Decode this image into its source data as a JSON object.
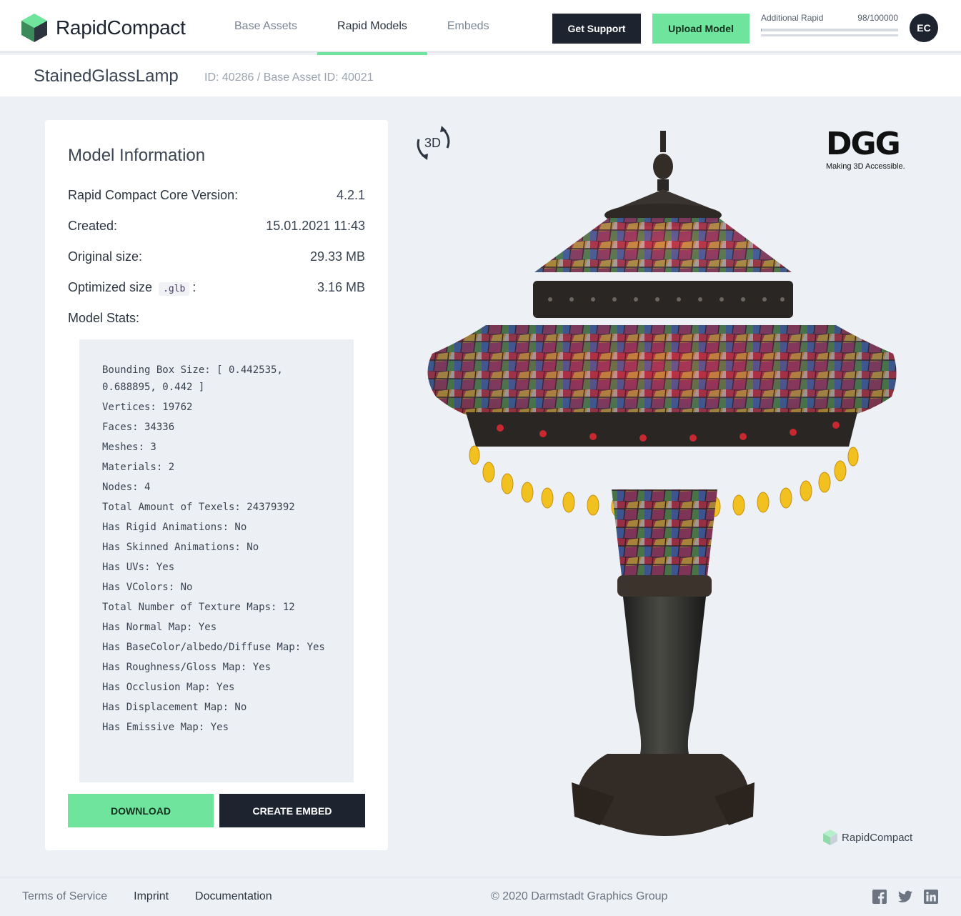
{
  "header": {
    "logo_text": "RapidCompact",
    "nav": [
      {
        "label": "Base Assets",
        "active": false
      },
      {
        "label": "Rapid Models",
        "active": true
      },
      {
        "label": "Embeds",
        "active": false
      }
    ],
    "support_label": "Get Support",
    "upload_label": "Upload Model",
    "quota_label": "Additional Rapid",
    "quota_value": "98/100000",
    "quota_fraction": 0.00098,
    "avatar_initials": "EC"
  },
  "model": {
    "name": "StainedGlassLamp",
    "ids": "ID: 40286 / Base Asset ID: 40021"
  },
  "info": {
    "title": "Model Information",
    "core_version_label": "Rapid Compact Core Version:",
    "core_version": "4.2.1",
    "created_label": "Created:",
    "created": "15.01.2021 11:43",
    "original_size_label": "Original size:",
    "original_size": "29.33 MB",
    "optimized_size_label": "Optimized size",
    "optimized_ext": ".glb",
    "optimized_colon": ":",
    "optimized_size": "3.16 MB",
    "stats_label": "Model Stats:",
    "stats": [
      "Bounding Box Size: [ 0.442535, 0.688895, 0.442 ]",
      "Vertices: 19762",
      "Faces: 34336",
      "Meshes: 3",
      "Materials: 2",
      "Nodes: 4",
      "Total Amount of Texels: 24379392",
      "Has Rigid Animations: No",
      "Has Skinned Animations: No",
      "Has UVs: Yes",
      "Has VColors: No",
      "Total Number of Texture Maps: 12",
      "Has Normal Map: Yes",
      "Has BaseColor/albedo/Diffuse Map: Yes",
      "Has Roughness/Gloss Map: Yes",
      "Has Occlusion Map: Yes",
      "Has Displacement Map: No",
      "Has Emissive Map: Yes"
    ],
    "download_label": "DOWNLOAD",
    "embed_label": "CREATE EMBED"
  },
  "viewer": {
    "badge_3d": "3D",
    "brand_logo": "DGG",
    "brand_tagline": "Making 3D Accessible.",
    "watermark": "RapidCompact"
  },
  "footer": {
    "links": [
      "Terms of Service",
      "Imprint",
      "Documentation"
    ],
    "copyright": "© 2020 Darmstadt Graphics Group",
    "social_icons": [
      "facebook-icon",
      "twitter-icon",
      "linkedin-icon"
    ]
  },
  "colors": {
    "accent": "#6ee49c",
    "dark": "#1d2430",
    "background": "#edf1f5"
  }
}
